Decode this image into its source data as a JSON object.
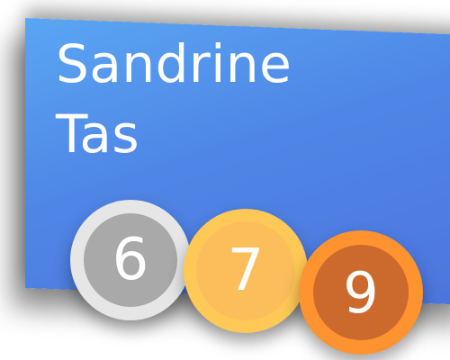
{
  "profile": {
    "first_name": "Sandrine",
    "last_name": "Tas"
  },
  "badges": [
    {
      "value": "6",
      "medal": "silver-medal-icon"
    },
    {
      "value": "7",
      "medal": "gold-medal-icon"
    },
    {
      "value": "9",
      "medal": "bronze-medal-icon"
    }
  ],
  "colors": {
    "card_gradient_start": "#5aa6f3",
    "card_gradient_end": "#4d75dc",
    "silver_rim": "#e6e6e6",
    "silver_face": "#a9a9a9",
    "gold_rim": "#ffc857",
    "gold_face": "#fcbe5b",
    "bronze_rim": "#ff9330",
    "bronze_face": "#cc6a2e"
  }
}
